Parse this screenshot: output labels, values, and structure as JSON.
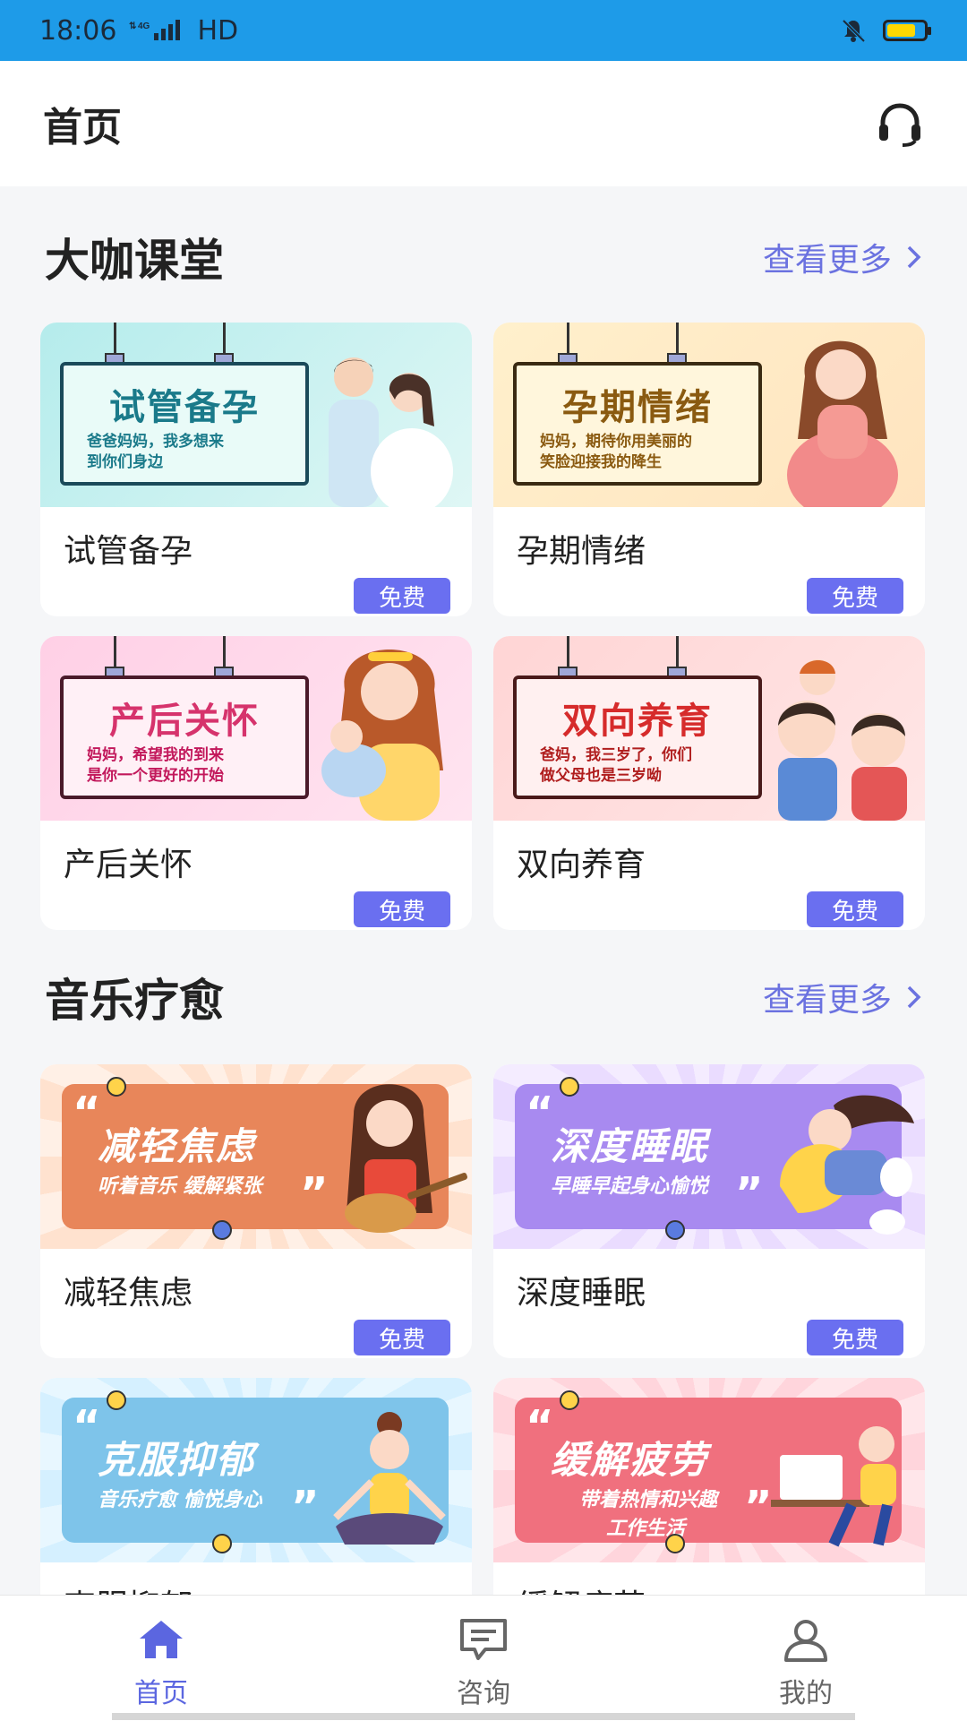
{
  "status_bar": {
    "time": "18:06",
    "network": "4G",
    "hd": "HD",
    "colors": {
      "bar": "#1e9be8",
      "battery": "#ffd800"
    },
    "battery_level": 0.78
  },
  "header": {
    "title": "首页",
    "support_icon": "headset-icon"
  },
  "sections": [
    {
      "title": "大咖课堂",
      "more_label": "查看更多",
      "cards": [
        {
          "title": "试管备孕",
          "badge": "免费",
          "banner_title": "试管备孕",
          "banner_sub": [
            "爸爸妈妈，我多想来",
            "到你们身边"
          ]
        },
        {
          "title": "孕期情绪",
          "badge": "免费",
          "banner_title": "孕期情绪",
          "banner_sub": [
            "妈妈，期待你用美丽的",
            "笑脸迎接我的降生"
          ]
        },
        {
          "title": "产后关怀",
          "badge": "免费",
          "banner_title": "产后关怀",
          "banner_sub": [
            "妈妈，希望我的到来",
            "是你一个更好的开始"
          ]
        },
        {
          "title": "双向养育",
          "badge": "免费",
          "banner_title": "双向养育",
          "banner_sub": [
            "爸妈，我三岁了，你们",
            "做父母也是三岁呦"
          ]
        }
      ]
    },
    {
      "title": "音乐疗愈",
      "more_label": "查看更多",
      "cards": [
        {
          "title": "减轻焦虑",
          "badge": "免费",
          "banner_title": "减轻焦虑",
          "banner_sub": [
            "听着音乐 缓解紧张"
          ]
        },
        {
          "title": "深度睡眠",
          "badge": "免费",
          "banner_title": "深度睡眠",
          "banner_sub": [
            "早睡早起身心愉悦"
          ]
        },
        {
          "title": "克服抑郁",
          "badge": "",
          "banner_title": "克服抑郁",
          "banner_sub": [
            "音乐疗愈 愉悦身心"
          ]
        },
        {
          "title": "缓解疲劳",
          "badge": "",
          "banner_title": "缓解疲劳",
          "banner_sub": [
            "带着热情和兴趣",
            "工作生活"
          ]
        }
      ]
    }
  ],
  "tabbar": {
    "items": [
      {
        "label": "首页",
        "icon": "home-icon",
        "active": true
      },
      {
        "label": "咨询",
        "icon": "chat-icon",
        "active": false
      },
      {
        "label": "我的",
        "icon": "user-icon",
        "active": false
      }
    ],
    "colors": {
      "active": "#5b66e0",
      "inactive": "#666666"
    }
  },
  "accent": "#6a6ff0"
}
